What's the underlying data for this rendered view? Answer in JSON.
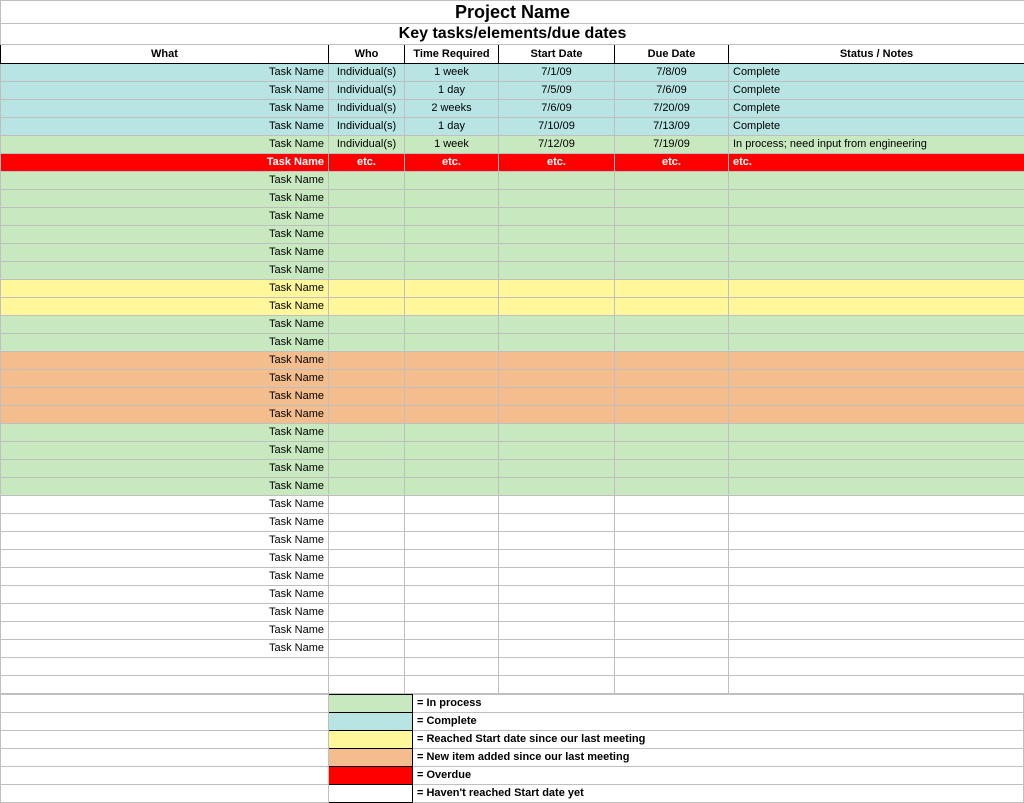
{
  "title": "Project Name",
  "subtitle": "Key tasks/elements/due dates",
  "columns": {
    "what": "What",
    "who": "Who",
    "time": "Time Required",
    "start": "Start Date",
    "due": "Due Date",
    "status": "Status / Notes"
  },
  "rows": [
    {
      "style": "blue",
      "what": "Task Name",
      "who": "Individual(s)",
      "time": "1 week",
      "start": "7/1/09",
      "due": "7/8/09",
      "status": "Complete"
    },
    {
      "style": "blue",
      "what": "Task Name",
      "who": "Individual(s)",
      "time": "1 day",
      "start": "7/5/09",
      "due": "7/6/09",
      "status": "Complete"
    },
    {
      "style": "blue",
      "what": "Task Name",
      "who": "Individual(s)",
      "time": "2 weeks",
      "start": "7/6/09",
      "due": "7/20/09",
      "status": "Complete"
    },
    {
      "style": "blue",
      "what": "Task Name",
      "who": "Individual(s)",
      "time": "1 day",
      "start": "7/10/09",
      "due": "7/13/09",
      "status": "Complete"
    },
    {
      "style": "green",
      "what": "Task Name",
      "who": "Individual(s)",
      "time": "1 week",
      "start": "7/12/09",
      "due": "7/19/09",
      "status": "In process; need input from engineering"
    },
    {
      "style": "red",
      "what": "Task Name",
      "who": "etc.",
      "time": "etc.",
      "start": "etc.",
      "due": "etc.",
      "status": "etc."
    },
    {
      "style": "green",
      "what": "Task Name",
      "who": "",
      "time": "",
      "start": "",
      "due": "",
      "status": ""
    },
    {
      "style": "green",
      "what": "Task Name",
      "who": "",
      "time": "",
      "start": "",
      "due": "",
      "status": ""
    },
    {
      "style": "green",
      "what": "Task Name",
      "who": "",
      "time": "",
      "start": "",
      "due": "",
      "status": ""
    },
    {
      "style": "green",
      "what": "Task Name",
      "who": "",
      "time": "",
      "start": "",
      "due": "",
      "status": ""
    },
    {
      "style": "green",
      "what": "Task Name",
      "who": "",
      "time": "",
      "start": "",
      "due": "",
      "status": ""
    },
    {
      "style": "green",
      "what": "Task Name",
      "who": "",
      "time": "",
      "start": "",
      "due": "",
      "status": ""
    },
    {
      "style": "yellow",
      "what": "Task Name",
      "who": "",
      "time": "",
      "start": "",
      "due": "",
      "status": ""
    },
    {
      "style": "yellow",
      "what": "Task Name",
      "who": "",
      "time": "",
      "start": "",
      "due": "",
      "status": ""
    },
    {
      "style": "green",
      "what": "Task Name",
      "who": "",
      "time": "",
      "start": "",
      "due": "",
      "status": ""
    },
    {
      "style": "green",
      "what": "Task Name",
      "who": "",
      "time": "",
      "start": "",
      "due": "",
      "status": ""
    },
    {
      "style": "orange",
      "what": "Task Name",
      "who": "",
      "time": "",
      "start": "",
      "due": "",
      "status": ""
    },
    {
      "style": "orange",
      "what": "Task Name",
      "who": "",
      "time": "",
      "start": "",
      "due": "",
      "status": ""
    },
    {
      "style": "orange",
      "what": "Task Name",
      "who": "",
      "time": "",
      "start": "",
      "due": "",
      "status": ""
    },
    {
      "style": "orange",
      "what": "Task Name",
      "who": "",
      "time": "",
      "start": "",
      "due": "",
      "status": ""
    },
    {
      "style": "green",
      "what": "Task Name",
      "who": "",
      "time": "",
      "start": "",
      "due": "",
      "status": ""
    },
    {
      "style": "green",
      "what": "Task Name",
      "who": "",
      "time": "",
      "start": "",
      "due": "",
      "status": ""
    },
    {
      "style": "green",
      "what": "Task Name",
      "who": "",
      "time": "",
      "start": "",
      "due": "",
      "status": ""
    },
    {
      "style": "green",
      "what": "Task Name",
      "who": "",
      "time": "",
      "start": "",
      "due": "",
      "status": ""
    },
    {
      "style": "white",
      "what": "Task Name",
      "who": "",
      "time": "",
      "start": "",
      "due": "",
      "status": ""
    },
    {
      "style": "white",
      "what": "Task Name",
      "who": "",
      "time": "",
      "start": "",
      "due": "",
      "status": ""
    },
    {
      "style": "white",
      "what": "Task Name",
      "who": "",
      "time": "",
      "start": "",
      "due": "",
      "status": ""
    },
    {
      "style": "white",
      "what": "Task Name",
      "who": "",
      "time": "",
      "start": "",
      "due": "",
      "status": ""
    },
    {
      "style": "white",
      "what": "Task Name",
      "who": "",
      "time": "",
      "start": "",
      "due": "",
      "status": ""
    },
    {
      "style": "white",
      "what": "Task Name",
      "who": "",
      "time": "",
      "start": "",
      "due": "",
      "status": ""
    },
    {
      "style": "white",
      "what": "Task Name",
      "who": "",
      "time": "",
      "start": "",
      "due": "",
      "status": ""
    },
    {
      "style": "white",
      "what": "Task Name",
      "who": "",
      "time": "",
      "start": "",
      "due": "",
      "status": ""
    },
    {
      "style": "white",
      "what": "Task Name",
      "who": "",
      "time": "",
      "start": "",
      "due": "",
      "status": ""
    }
  ],
  "legend": [
    {
      "color": "green",
      "label": "= In process"
    },
    {
      "color": "blue",
      "label": "= Complete"
    },
    {
      "color": "yellow",
      "label": "= Reached Start date since our last meeting"
    },
    {
      "color": "orange",
      "label": "= New item added since our last meeting"
    },
    {
      "color": "red",
      "label": "= Overdue"
    },
    {
      "color": "white",
      "label": "= Haven't reached Start date yet"
    }
  ]
}
